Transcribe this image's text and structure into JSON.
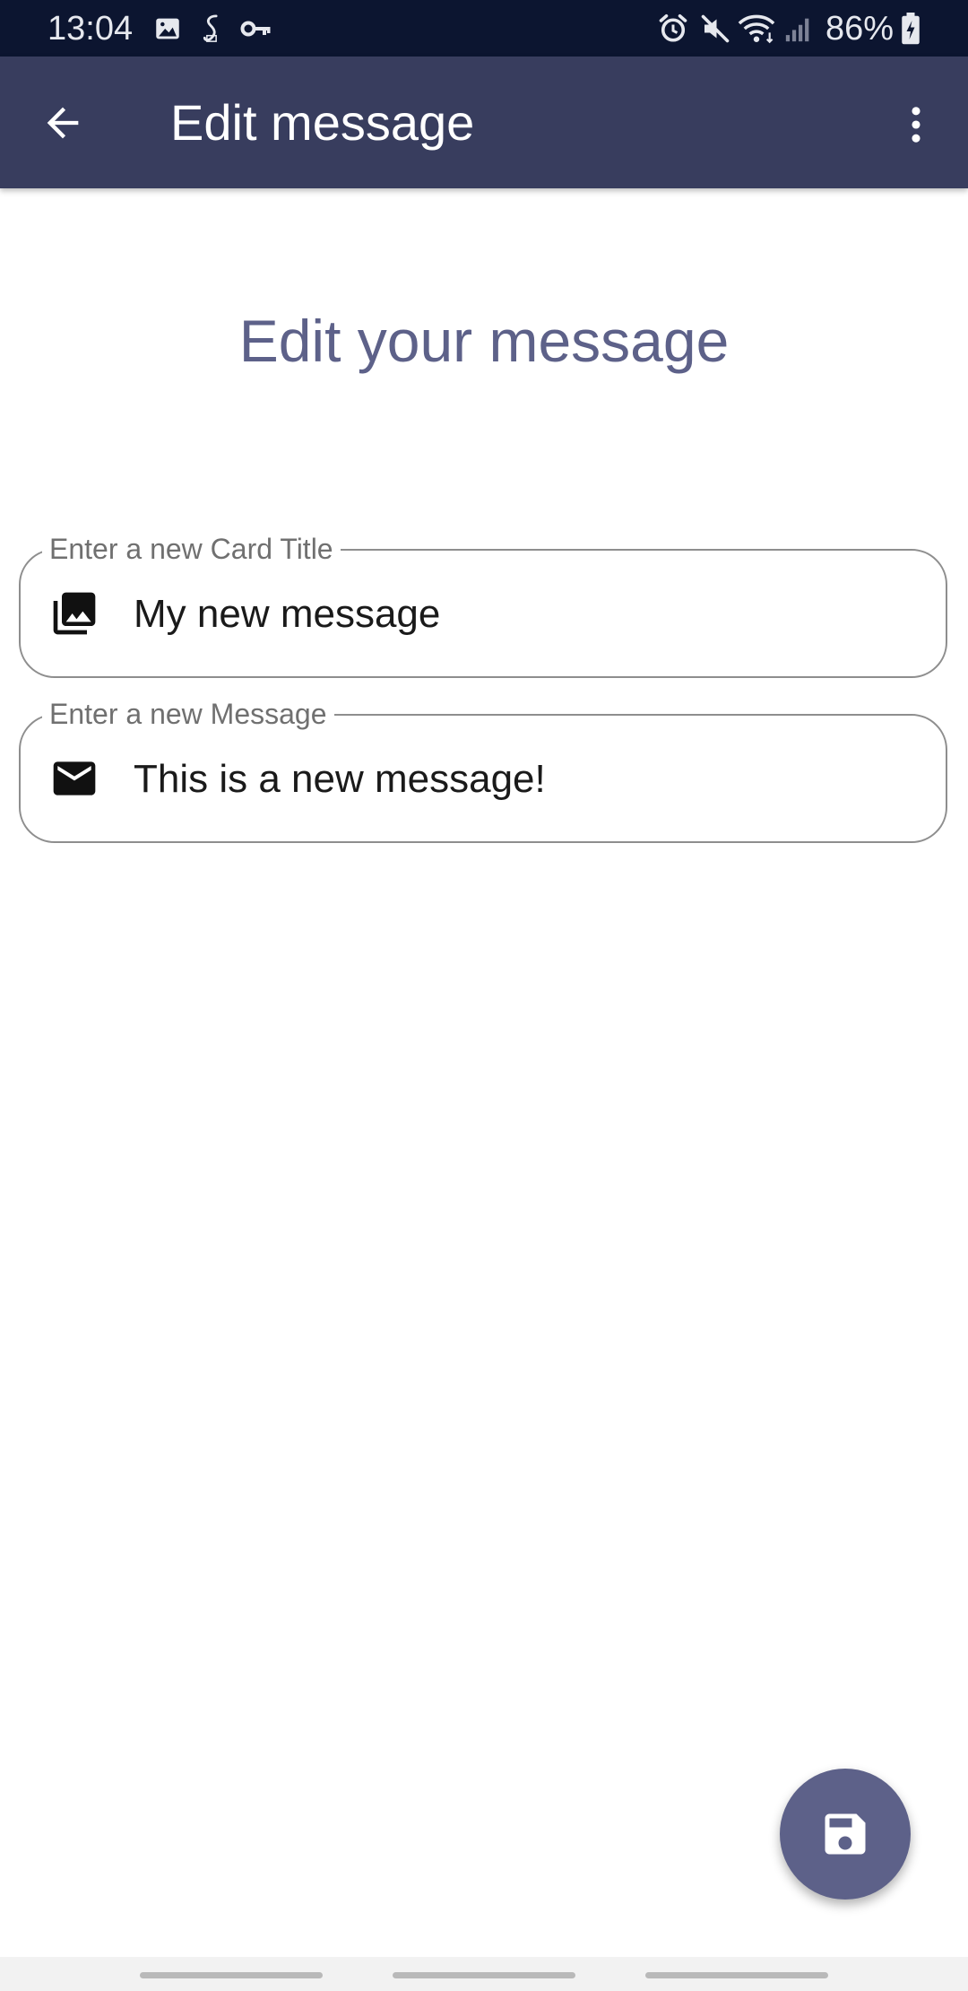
{
  "status_bar": {
    "time": "13:04",
    "battery_percent": "86%",
    "icons_left": [
      "image-icon",
      "s-health-icon",
      "key-icon"
    ],
    "icons_right": [
      "alarm-icon",
      "mute-icon",
      "wifi-icon",
      "signal-icon",
      "battery-charging-icon"
    ]
  },
  "app_bar": {
    "title": "Edit message",
    "back_icon": "arrow-back-icon",
    "menu_icon": "more-vert-icon"
  },
  "main": {
    "heading": "Edit your message",
    "fields": [
      {
        "label": "Enter a new Card Title",
        "value": "My new message",
        "icon": "photo-library-icon"
      },
      {
        "label": "Enter a new Message",
        "value": "This is a new message!",
        "icon": "mail-icon"
      }
    ]
  },
  "fab": {
    "icon": "save-icon"
  },
  "colors": {
    "status_bar": "#0c1530",
    "app_bar": "#383d5e",
    "accent": "#5d6189",
    "field_border": "#8e8e8e"
  }
}
